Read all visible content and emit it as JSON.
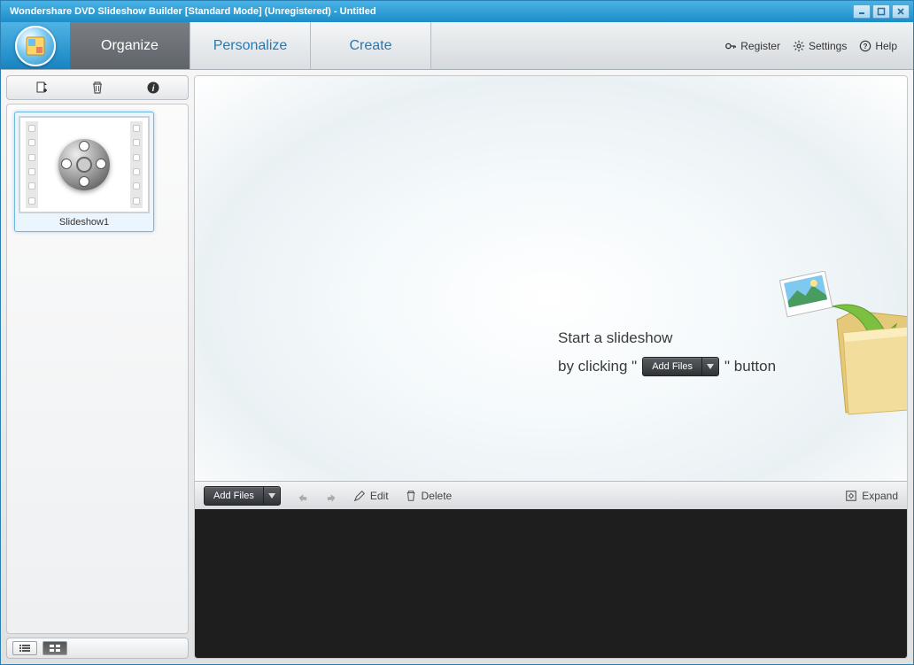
{
  "window": {
    "title": "Wondershare DVD Slideshow Builder [Standard Mode] (Unregistered) - Untitled"
  },
  "tabs": {
    "organize": "Organize",
    "personalize": "Personalize",
    "create": "Create"
  },
  "header_links": {
    "register": "Register",
    "settings": "Settings",
    "help": "Help"
  },
  "sidebar": {
    "slideshow_label": "Slideshow1"
  },
  "hint": {
    "line1": "Start a slideshow",
    "line2_pre": "by clicking \"",
    "add_files": "Add Files",
    "line2_post": "\"  button"
  },
  "bottom": {
    "add_files": "Add Files",
    "edit": "Edit",
    "delete": "Delete",
    "expand": "Expand"
  }
}
